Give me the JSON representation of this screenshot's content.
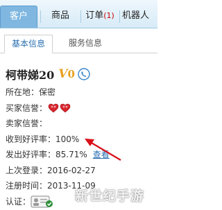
{
  "nav": {
    "tabs": [
      {
        "label": "客户"
      },
      {
        "label": "商品"
      },
      {
        "label": "订单",
        "badge": "(1)"
      },
      {
        "label": "机器人"
      }
    ]
  },
  "subtabs": [
    {
      "label": "基本信息"
    },
    {
      "label": "服务信息"
    }
  ],
  "profile": {
    "name": "柯带娣20",
    "vip_v": "V",
    "vip_level": "0",
    "location_label": "所在地：",
    "location_value": "保密",
    "buyer_credit_label": "买家信誉：",
    "seller_credit_label": "卖家信誉：",
    "received_rate_label": "收到好评率：",
    "received_rate_value": "100%",
    "given_rate_label": "发出好评率：",
    "given_rate_value": "85.71%",
    "view_link": "查看",
    "last_login_label": "上次登录：",
    "last_login_value": "2016-02-27",
    "register_label": "注册时间：",
    "register_value": "2013-11-09",
    "verify_label": "认证："
  },
  "watermark": "新世纪手游",
  "colors": {
    "accent_blue": "#2a6fb0",
    "tab_active": "#7fb7e0",
    "heart_red": "#d8262e",
    "vip_gold": "#e8a020",
    "arrow_red": "#d8101a"
  },
  "icons": {
    "phone": "phone-icon",
    "credit": "heart-icon",
    "verify": "verified-badge-icon"
  }
}
